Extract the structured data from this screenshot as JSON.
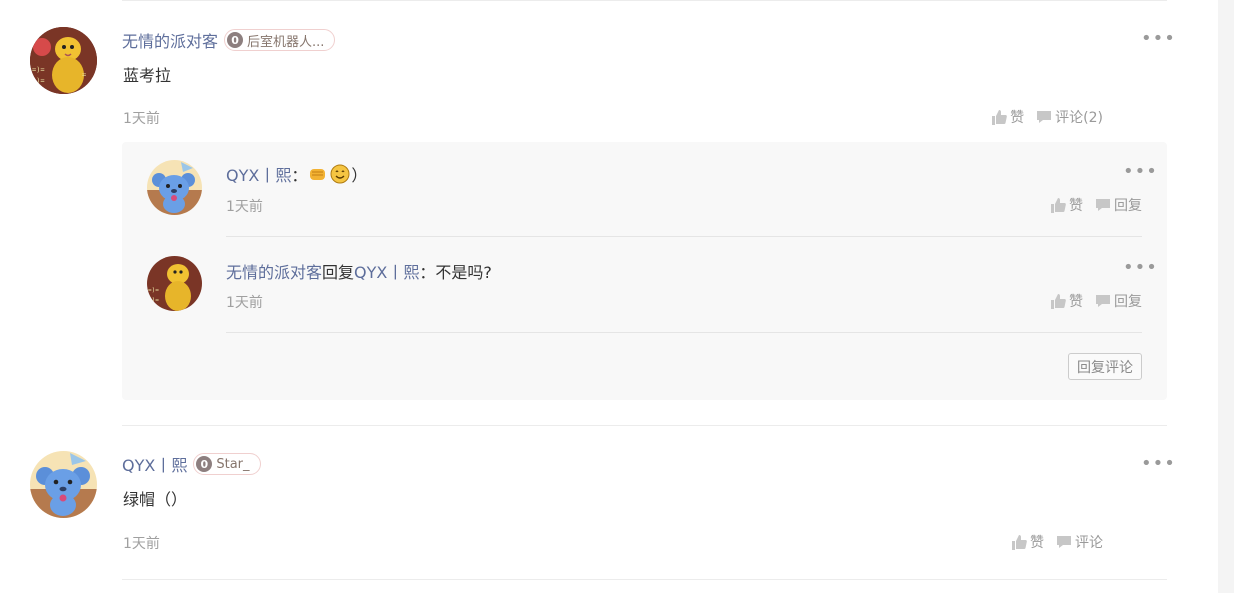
{
  "comments": [
    {
      "author": "无情的派对客",
      "badge": {
        "level": "0",
        "label": "后室机器人..."
      },
      "text": "蓝考拉",
      "time": "1天前",
      "like_label": "赞",
      "comment_label": "评论(2)",
      "replies": [
        {
          "author": "QYX丨熙",
          "separator": "：",
          "text_end": "）",
          "emojis": [
            "fist-emoji",
            "smile-emoji"
          ],
          "time": "1天前",
          "like_label": "赞",
          "reply_label": "回复"
        },
        {
          "author": "无情的派对客",
          "reply_word": "回复",
          "target": "QYX丨熙",
          "separator": "：",
          "text": "不是吗?",
          "time": "1天前",
          "like_label": "赞",
          "reply_label": "回复"
        }
      ],
      "reply_comment_button": "回复评论"
    },
    {
      "author": "QYX丨熙",
      "badge": {
        "level": "0",
        "label": "Star_"
      },
      "text": "绿帽（）",
      "time": "1天前",
      "like_label": "赞",
      "comment_label": "评论"
    }
  ],
  "more_icon": "•••",
  "colors": {
    "author": "#5e6e9b",
    "badge_border": "#f0d0cf",
    "reply_bg": "#f8f8f8"
  }
}
